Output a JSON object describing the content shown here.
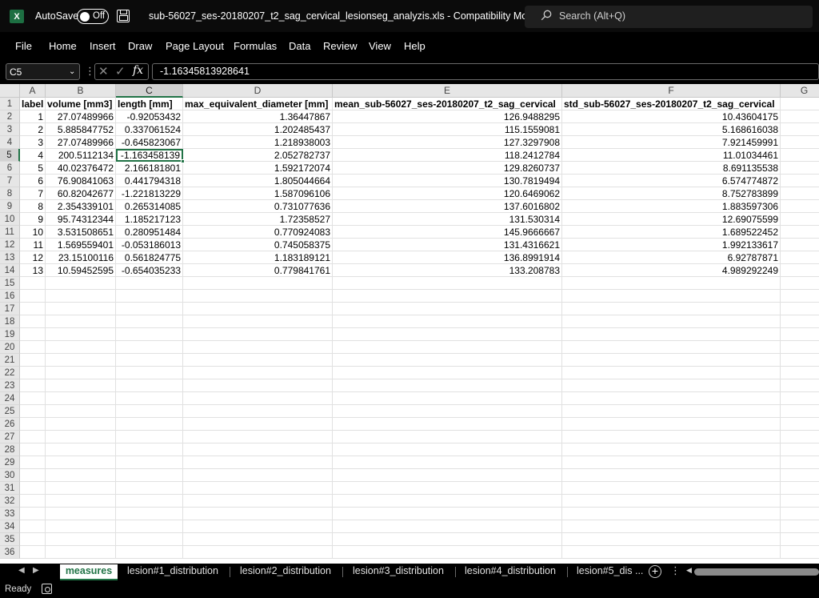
{
  "titlebar": {
    "app_logo": "X",
    "autosave_label": "AutoSave",
    "toggle_state": "Off",
    "document_title": "sub-56027_ses-20180207_t2_sag_cervical_lesionseg_analyzis.xls  -  Compatibility Mode",
    "dropdown_glyph": "▾",
    "search_placeholder": "Search (Alt+Q)"
  },
  "menu": [
    "File",
    "Home",
    "Insert",
    "Draw",
    "Page Layout",
    "Formulas",
    "Data",
    "Review",
    "View",
    "Help"
  ],
  "formula_bar": {
    "name_box": "C5",
    "fx": "fx",
    "formula": "-1.16345813928641"
  },
  "columns": [
    "A",
    "B",
    "C",
    "D",
    "E",
    "F",
    "G"
  ],
  "headers": [
    "label",
    "volume [mm3]",
    "length [mm]",
    "max_equivalent_diameter [mm]",
    "mean_sub-56027_ses-20180207_t2_sag_cervical",
    "std_sub-56027_ses-20180207_t2_sag_cervical"
  ],
  "rows": [
    [
      "1",
      "27.07489966",
      "-0.92053432",
      "1.36447867",
      "126.9488295",
      "10.43604175"
    ],
    [
      "2",
      "5.885847752",
      "0.337061524",
      "1.202485437",
      "115.1559081",
      "5.168616038"
    ],
    [
      "3",
      "27.07489966",
      "-0.645823067",
      "1.218938003",
      "127.3297908",
      "7.921459991"
    ],
    [
      "4",
      "200.5112134",
      "-1.163458139",
      "2.052782737",
      "118.2412784",
      "11.01034461"
    ],
    [
      "5",
      "40.02376472",
      "2.166181801",
      "1.592172074",
      "129.8260737",
      "8.691135538"
    ],
    [
      "6",
      "76.90841063",
      "0.441794318",
      "1.805044664",
      "130.7819494",
      "6.574774872"
    ],
    [
      "7",
      "60.82042677",
      "-1.221813229",
      "1.587096106",
      "120.6469062",
      "8.752783899"
    ],
    [
      "8",
      "2.354339101",
      "0.265314085",
      "0.731077636",
      "137.6016802",
      "1.883597306"
    ],
    [
      "9",
      "95.74312344",
      "1.185217123",
      "1.72358527",
      "131.530314",
      "12.69075599"
    ],
    [
      "10",
      "3.531508651",
      "0.280951484",
      "0.770924083",
      "145.9666667",
      "1.689522452"
    ],
    [
      "11",
      "1.569559401",
      "-0.053186013",
      "0.745058375",
      "131.4316621",
      "1.992133617"
    ],
    [
      "12",
      "23.15100116",
      "0.561824775",
      "1.183189121",
      "136.8991914",
      "6.92787871"
    ],
    [
      "13",
      "10.59452595",
      "-0.654035233",
      "0.779841761",
      "133.208783",
      "4.989292249"
    ]
  ],
  "row_numbers": [
    "1",
    "2",
    "3",
    "4",
    "5",
    "6",
    "7",
    "8",
    "9",
    "10",
    "11",
    "12",
    "13",
    "14",
    "15",
    "16",
    "17",
    "18",
    "19",
    "20",
    "21",
    "22",
    "23",
    "24",
    "25",
    "26",
    "27",
    "28",
    "29",
    "30",
    "31",
    "32",
    "33",
    "34",
    "35",
    "36"
  ],
  "sheet_tabs": [
    "measures",
    "lesion#1_distribution",
    "lesion#2_distribution",
    "lesion#3_distribution",
    "lesion#4_distribution",
    "lesion#5_dis ..."
  ],
  "status": {
    "mode": "Ready"
  },
  "colors": {
    "accent": "#217346",
    "chrome": "#000000",
    "header_bg": "#e6e6e6"
  }
}
